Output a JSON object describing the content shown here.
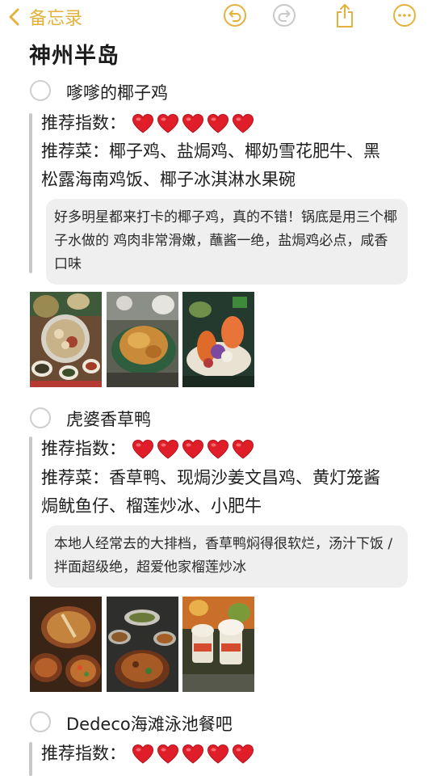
{
  "toolbar": {
    "back_label": "备忘录",
    "icons": [
      "chevron-left-icon",
      "undo-icon",
      "redo-icon",
      "share-icon",
      "more-icon"
    ],
    "accent": "#e3b23c"
  },
  "note": {
    "title": "神州半岛",
    "entries": [
      {
        "name": "嗲嗲的椰子鸡",
        "rating_label": "推荐指数：",
        "rating": 5,
        "dishes_line1": "推荐菜：椰子鸡、盐焗鸡、椰奶雪花肥牛、黑",
        "dishes_line2": "松露海南鸡饭、椰子冰淇淋水果碗",
        "comment": "好多明星都来打卡的椰子鸡，真的不错！锅底是用三个椰子水做的  鸡肉非常滑嫩，蘸酱一绝，盐焗鸡必点，咸香口味"
      },
      {
        "name": "虎婆香草鸭",
        "rating_label": "推荐指数：",
        "rating": 5,
        "dishes_line1": "推荐菜：香草鸭、现焗沙姜文昌鸡、黄灯笼酱",
        "dishes_line2": "焗鱿鱼仔、榴莲炒冰、小肥牛",
        "comment": "本地人经常去的大排档，香草鸭焖得很软烂，汤汁下饭 / 拌面超级绝，超爱他家榴莲炒冰"
      },
      {
        "name": "Dedeco海滩泳池餐吧",
        "rating_label": "推荐指数：",
        "rating": 5
      }
    ]
  },
  "colors": {
    "heart": "#e01e2a",
    "note_bg": "#efefef",
    "quote_bar": "#c8c8c8"
  }
}
